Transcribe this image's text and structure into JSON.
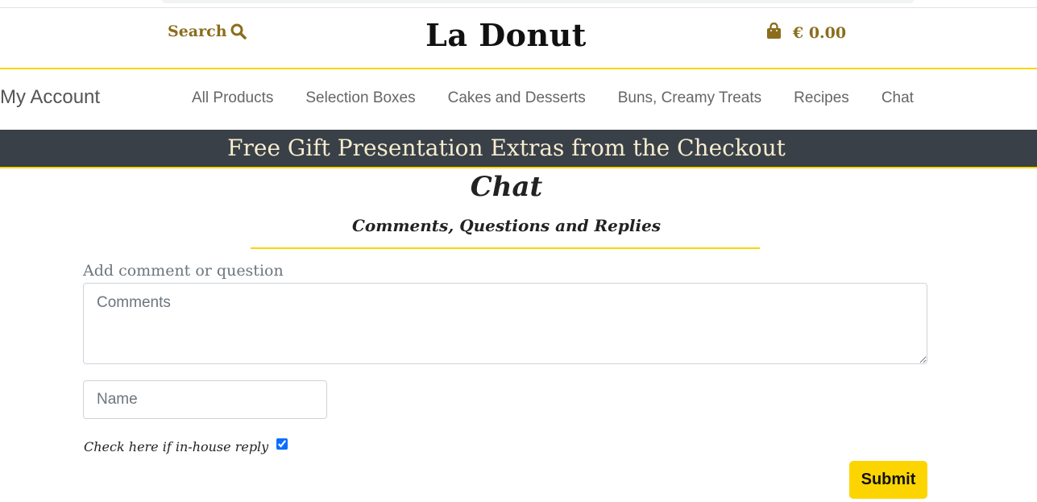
{
  "header": {
    "search_label": "Search",
    "brand": "La Donut",
    "cart_total": "€ 0.00"
  },
  "nav": {
    "account": "My Account",
    "links": [
      "All Products",
      "Selection Boxes",
      "Cakes and Desserts",
      "Buns, Creamy Treats",
      "Recipes",
      "Chat"
    ]
  },
  "banner": {
    "text": "Free Gift Presentation Extras from the Checkout"
  },
  "page": {
    "title": "Chat",
    "subtitle": "Comments, Questions and Replies"
  },
  "form": {
    "comment_label": "Add comment or question",
    "comments_placeholder": "Comments",
    "name_placeholder": "Name",
    "inhouse_label": "Check here if in-house reply",
    "inhouse_checked": true,
    "submit_label": "Submit"
  },
  "colors": {
    "accent": "#fcd500",
    "gold_text": "#8b6d1d",
    "banner_bg": "#3a4047"
  },
  "icons": {
    "search": "search-icon",
    "cart": "shopping-bag-icon"
  }
}
